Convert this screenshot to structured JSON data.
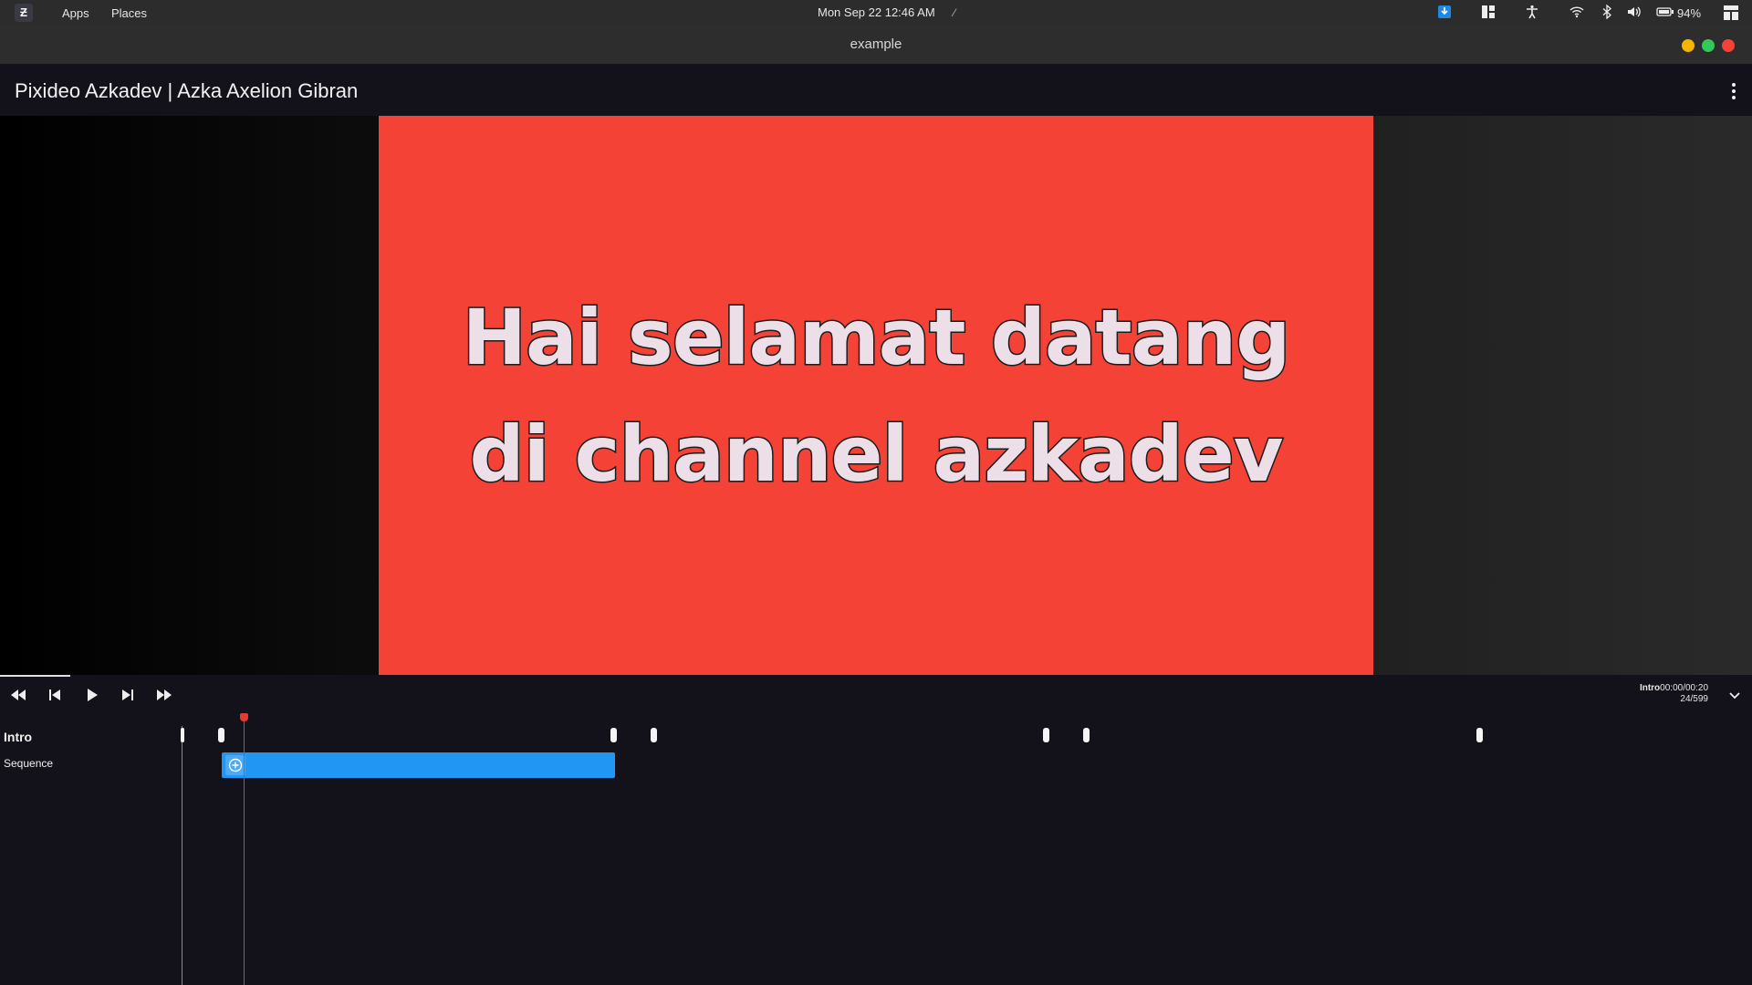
{
  "system_bar": {
    "menu": [
      "Apps",
      "Places"
    ],
    "clock": "Mon Sep 22  12:46 AM",
    "battery_percent": "94%",
    "tray_icons": [
      "download-icon",
      "layout-icon",
      "accessibility-icon",
      "wifi-icon",
      "bluetooth-icon",
      "volume-icon",
      "battery-icon",
      "panel-icon"
    ]
  },
  "window": {
    "title": "example",
    "controls": [
      "minimize",
      "maximize",
      "close"
    ],
    "control_colors": {
      "minimize": "#f4b400",
      "maximize": "#34c759",
      "close": "#f44336"
    }
  },
  "app": {
    "title": "Pixideo Azkadev | Azka Axelion Gibran"
  },
  "preview": {
    "background_color": "#f44336",
    "caption": "Hai selamat datang di channel azkadev"
  },
  "transport": {
    "buttons": [
      "rewind",
      "skip-previous",
      "play",
      "skip-next",
      "fast-forward"
    ],
    "scene_name": "Intro",
    "time": "00:00/00:20",
    "frame": "24/599"
  },
  "timeline": {
    "scene_label": "Intro",
    "track_label": "Sequence",
    "clip_color": "#2196f3",
    "playhead_color": "#e53935"
  }
}
